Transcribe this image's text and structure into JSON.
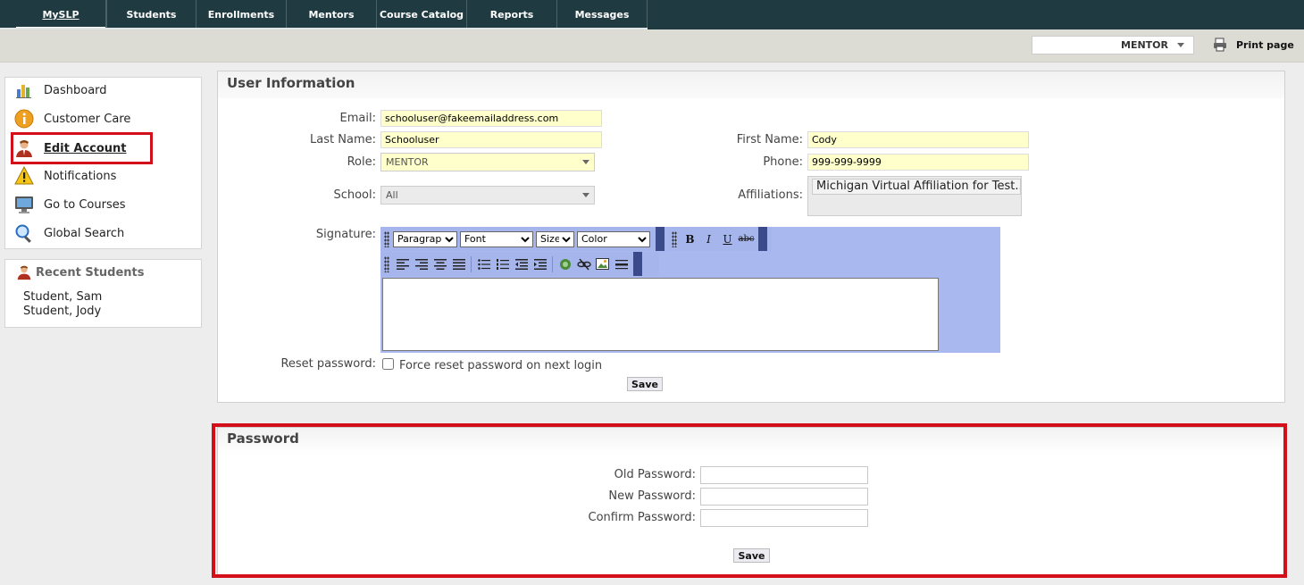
{
  "nav": {
    "items": [
      "MySLP",
      "Students",
      "Enrollments",
      "Mentors",
      "Course Catalog",
      "Reports",
      "Messages"
    ],
    "active": "MySLP"
  },
  "subbar": {
    "role": "MENTOR",
    "print_label": "Print page"
  },
  "sidebar": {
    "items": [
      {
        "label": "Dashboard",
        "icon": "dashboard-chart-icon"
      },
      {
        "label": "Customer Care",
        "icon": "info-icon"
      },
      {
        "label": "Edit Account",
        "icon": "user-icon"
      },
      {
        "label": "Notifications",
        "icon": "warning-icon"
      },
      {
        "label": "Go to Courses",
        "icon": "monitor-icon"
      },
      {
        "label": "Global Search",
        "icon": "magnifier-icon"
      }
    ],
    "current": "Edit Account",
    "recent_title": "Recent Students",
    "recent": [
      "Student, Sam",
      "Student, Jody"
    ]
  },
  "user_info": {
    "title": "User Information",
    "email_label": "Email:",
    "email": "schooluser@fakeemailaddress.com",
    "last_name_label": "Last Name:",
    "last_name": "Schooluser",
    "first_name_label": "First Name:",
    "first_name": "Cody",
    "role_label": "Role:",
    "role": "MENTOR",
    "phone_label": "Phone:",
    "phone": "999-999-9999",
    "school_label": "School:",
    "school": "All",
    "affiliations_label": "Affiliations:",
    "affiliation": "Michigan Virtual Affiliation for Test...",
    "signature_label": "Signature:",
    "toolbar": {
      "paragraph": "Paragraph",
      "font": "Font",
      "size": "Size",
      "color": "Color",
      "bold": "B",
      "italic": "I",
      "underline": "U",
      "strike": "abc"
    },
    "reset_label": "Reset password:",
    "reset_checkbox_label": "Force reset password on next login",
    "save_label": "Save"
  },
  "password": {
    "title": "Password",
    "old_label": "Old Password:",
    "new_label": "New Password:",
    "confirm_label": "Confirm Password:",
    "save_label": "Save"
  },
  "colors": {
    "nav_bg": "#1f3a40",
    "highlight": "#d3101a",
    "field_bg": "#ffffcc",
    "editor_bg": "#a9b9ef"
  }
}
